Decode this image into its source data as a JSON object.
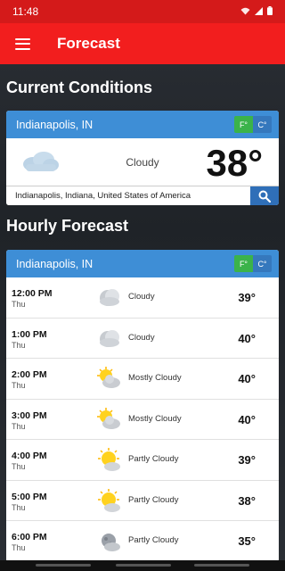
{
  "status": {
    "time": "11:48"
  },
  "app_bar": {
    "title": "Forecast"
  },
  "current": {
    "section_title": "Current Conditions",
    "location": "Indianapolis, IN",
    "unit_f": "F°",
    "unit_c": "C°",
    "condition": "Cloudy",
    "temperature": "38°",
    "search_value": "Indianapolis, Indiana, United States of America"
  },
  "hourly": {
    "section_title": "Hourly Forecast",
    "location": "Indianapolis, IN",
    "unit_f": "F°",
    "unit_c": "C°",
    "rows": [
      {
        "time": "12:00 PM",
        "day": "Thu",
        "icon": "cloudy",
        "condition": "Cloudy",
        "temp": "39°"
      },
      {
        "time": "1:00 PM",
        "day": "Thu",
        "icon": "cloudy",
        "condition": "Cloudy",
        "temp": "40°"
      },
      {
        "time": "2:00 PM",
        "day": "Thu",
        "icon": "mostly-cloudy",
        "condition": "Mostly Cloudy",
        "temp": "40°"
      },
      {
        "time": "3:00 PM",
        "day": "Thu",
        "icon": "mostly-cloudy",
        "condition": "Mostly Cloudy",
        "temp": "40°"
      },
      {
        "time": "4:00 PM",
        "day": "Thu",
        "icon": "partly-cloudy",
        "condition": "Partly Cloudy",
        "temp": "39°"
      },
      {
        "time": "5:00 PM",
        "day": "Thu",
        "icon": "partly-cloudy",
        "condition": "Partly Cloudy",
        "temp": "38°"
      },
      {
        "time": "6:00 PM",
        "day": "Thu",
        "icon": "partly-cloudy-night",
        "condition": "Partly Cloudy",
        "temp": "35°"
      }
    ]
  },
  "colors": {
    "status_bar": "#d41a1a",
    "app_bar": "#f21e1e",
    "card_header": "#3e8ed6",
    "unit_active": "#3bb34a"
  }
}
